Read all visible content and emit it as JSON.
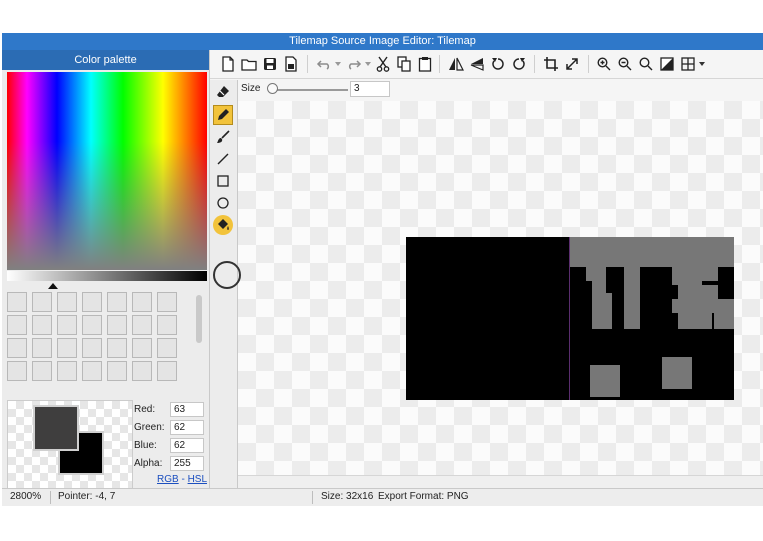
{
  "window": {
    "title": "Tilemap Source Image Editor: Tilemap"
  },
  "palette": {
    "header": "Color palette",
    "primary_color": "#3f3e3e",
    "secondary_color": "#000000",
    "channels": [
      {
        "label": "Red:",
        "value": "63"
      },
      {
        "label": "Green:",
        "value": "62"
      },
      {
        "label": "Blue:",
        "value": "62"
      },
      {
        "label": "Alpha:",
        "value": "255"
      }
    ],
    "mode_rgb": "RGB",
    "mode_separator": " - ",
    "mode_hsl": "HSL"
  },
  "toolbar": {
    "buttons": [
      "new-file-icon",
      "open-folder-icon",
      "save-icon",
      "save-as-icon",
      "undo-icon",
      "redo-icon",
      "cut-icon",
      "copy-icon",
      "paste-icon",
      "flip-horizontal-icon",
      "flip-vertical-icon",
      "rotate-left-icon",
      "rotate-right-icon",
      "crop-icon",
      "resize-icon",
      "zoom-in-icon",
      "zoom-out-icon",
      "zoom-fit-icon",
      "actual-size-icon",
      "grid-icon"
    ]
  },
  "size_control": {
    "label": "Size",
    "value": "3",
    "level_fraction": 0.05
  },
  "tools": {
    "items": [
      "eraser-tool",
      "pencil-tool",
      "brush-tool",
      "line-tool",
      "rectangle-tool",
      "ellipse-tool",
      "fill-bucket-tool"
    ],
    "active": "pencil-tool"
  },
  "status": {
    "zoom": "2800%",
    "pointer": "Pointer: -4, 7",
    "size": "Size: 32x16",
    "export": "Export Format: PNG"
  }
}
